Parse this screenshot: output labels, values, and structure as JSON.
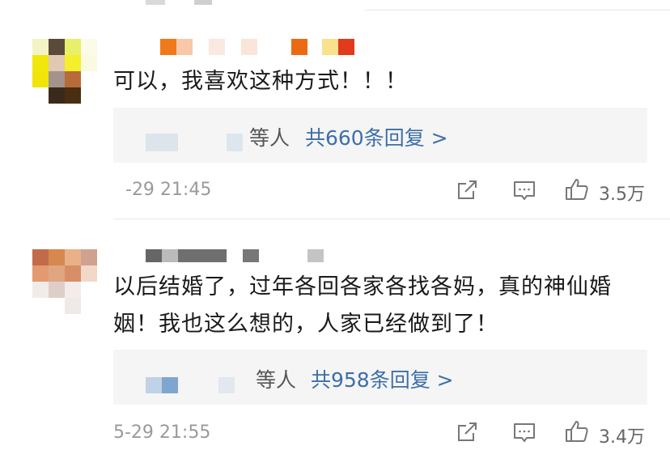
{
  "comments": [
    {
      "text": "可以，我喜欢这种方式！！！",
      "replies_suffix": "等人",
      "replies_link": "共660条回复 >",
      "timestamp": "-29 21:45",
      "likes": "3.5万"
    },
    {
      "text_line1": "以后结婚了，过年各回各家各找各妈，真的神仙婚",
      "text_line2": "姻！我也这么想的，人家已经做到了！",
      "replies_suffix": "等人",
      "replies_link": "共958条回复 >",
      "timestamp": "5-29 21:55",
      "likes": "3.4万"
    }
  ],
  "icons": {
    "share": "share-icon",
    "comment": "comment-icon",
    "like": "thumbs-up-icon"
  },
  "colors": {
    "link": "#3d6fa8",
    "timestamp": "#9a9a9a",
    "reply_box_bg": "#f5f5f5"
  }
}
